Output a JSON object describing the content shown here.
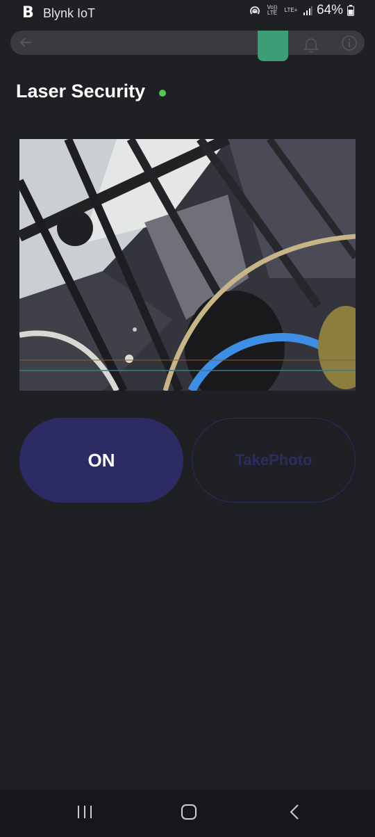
{
  "status_bar": {
    "app_name": "Blynk IoT",
    "logo_letter": "B",
    "volte_label": "Vo)) LTE",
    "lte_label": "LTE+",
    "battery": "64%"
  },
  "dashboard": {
    "title": "Laser Security",
    "online_color": "#5ac453"
  },
  "buttons": {
    "on_label": "ON",
    "photo_label": "TakePhoto"
  },
  "colors": {
    "accent_active_tab": "#3c9e77",
    "button_primary": "#2c2b63",
    "background": "#1f2024"
  },
  "icons": {
    "back": "arrow-left-icon",
    "bell": "bell-icon",
    "info": "info-icon",
    "recents": "recent-apps-icon",
    "home": "home-icon",
    "nav_back": "nav-back-icon"
  }
}
